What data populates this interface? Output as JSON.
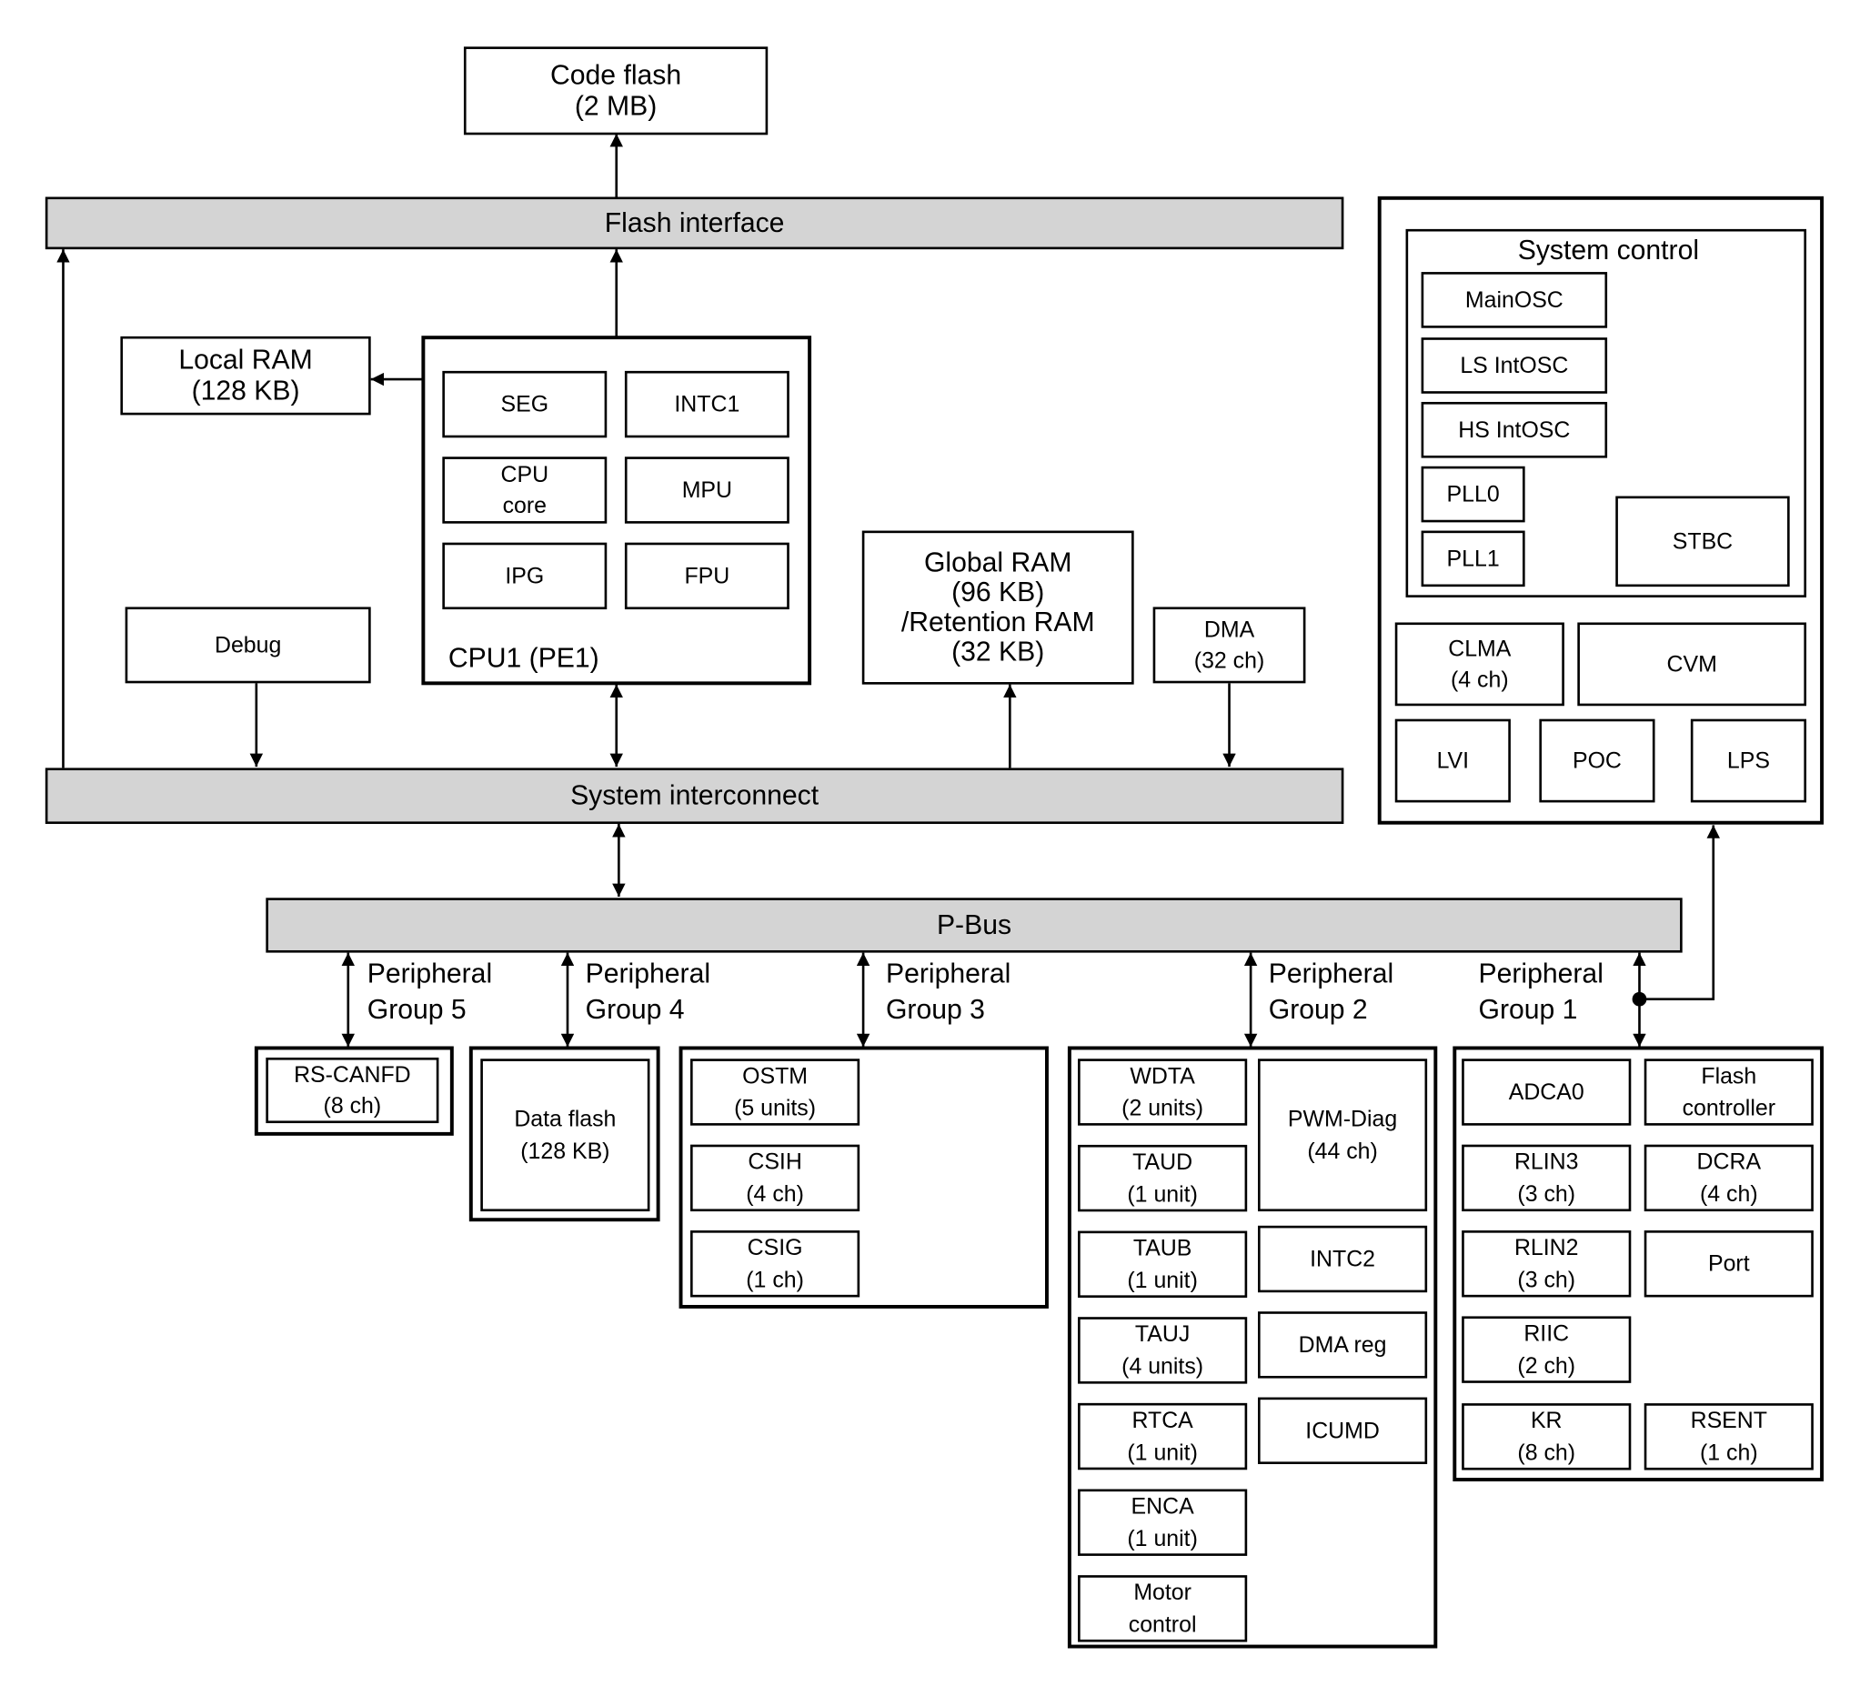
{
  "diagram": {
    "code_flash": [
      "Code flash",
      "(2 MB)"
    ],
    "flash_interface": "Flash interface",
    "local_ram": [
      "Local RAM",
      "(128 KB)"
    ],
    "cpu": {
      "label": "CPU1 (PE1)",
      "blocks": [
        [
          "SEG"
        ],
        [
          "INTC1"
        ],
        [
          "CPU",
          "core"
        ],
        [
          "MPU"
        ],
        [
          "IPG"
        ],
        [
          "FPU"
        ]
      ]
    },
    "debug": [
      "Debug"
    ],
    "global_ram": [
      "Global RAM",
      "(96 KB)",
      "/Retention RAM",
      "(32 KB)"
    ],
    "dma": [
      "DMA",
      "(32 ch)"
    ],
    "system_interconnect": "System interconnect",
    "p_bus": "P-Bus",
    "system_control": {
      "title": "System control",
      "blocks": [
        [
          "MainOSC"
        ],
        [
          "LS IntOSC"
        ],
        [
          "HS IntOSC"
        ],
        [
          "PLL0"
        ],
        [
          "PLL1"
        ],
        [
          "STBC"
        ]
      ],
      "lower_blocks": [
        [
          "CLMA",
          "(4 ch)"
        ],
        [
          "CVM"
        ],
        [
          "LVI"
        ],
        [
          "POC"
        ],
        [
          "LPS"
        ]
      ]
    },
    "groups": {
      "g5": {
        "label": [
          "Peripheral",
          "Group 5"
        ],
        "blocks": [
          [
            "RS-CANFD",
            "(8 ch)"
          ]
        ]
      },
      "g4": {
        "label": [
          "Peripheral",
          "Group 4"
        ],
        "blocks": [
          [
            "Data flash",
            "(128 KB)"
          ]
        ]
      },
      "g3": {
        "label": [
          "Peripheral",
          "Group 3"
        ],
        "blocks": [
          [
            "OSTM",
            "(5 units)"
          ],
          [
            "CSIH",
            "(4 ch)"
          ],
          [
            "CSIG",
            "(1 ch)"
          ]
        ]
      },
      "g2": {
        "label": [
          "Peripheral",
          "Group 2"
        ],
        "blocks": [
          [
            "WDTA",
            "(2 units)"
          ],
          [
            "TAUD",
            "(1 unit)"
          ],
          [
            "TAUB",
            "(1 unit)"
          ],
          [
            "TAUJ",
            "(4 units)"
          ],
          [
            "RTCA",
            "(1 unit)"
          ],
          [
            "ENCA",
            "(1 unit)"
          ],
          [
            "Motor",
            "control"
          ],
          [
            "PWM-Diag",
            "(44 ch)"
          ],
          [
            "INTC2"
          ],
          [
            "DMA reg"
          ],
          [
            "ICUMD"
          ]
        ]
      },
      "g1": {
        "label": [
          "Peripheral",
          "Group 1"
        ],
        "blocks": [
          [
            "ADCA0"
          ],
          [
            "Flash",
            "controller"
          ],
          [
            "RLIN3",
            "(3 ch)"
          ],
          [
            "DCRA",
            "(4 ch)"
          ],
          [
            "RLIN2",
            "(3 ch)"
          ],
          [
            "Port"
          ],
          [
            "RIIC",
            "(2 ch)"
          ],
          [
            "KR",
            "(8 ch)"
          ],
          [
            "RSENT",
            "(1 ch)"
          ]
        ]
      }
    }
  }
}
